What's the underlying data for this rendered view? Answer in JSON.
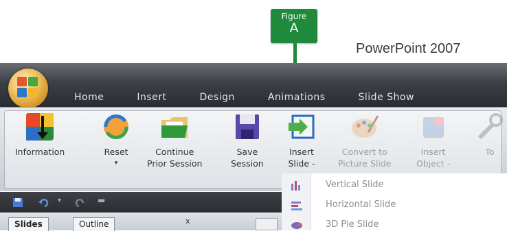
{
  "callout": {
    "line1": "Figure",
    "line2": "A"
  },
  "product_title": "PowerPoint 2007",
  "tabs": [
    "Home",
    "Insert",
    "Design",
    "Animations",
    "Slide Show"
  ],
  "ribbon": {
    "information": "Information",
    "reset": "Reset",
    "continue_l1": "Continue",
    "continue_l2": "Prior Session",
    "save_l1": "Save",
    "save_l2": "Session",
    "insert_l1": "Insert",
    "insert_l2": "Slide -",
    "convert_l1": "Convert to",
    "convert_l2": "Picture Slide",
    "insobj_l1": "Insert",
    "insobj_l2": "Object -",
    "cut_l1": "To"
  },
  "panes": {
    "slides": "Slides",
    "outline": "Outline",
    "close": "x"
  },
  "menu": [
    "Vertical Slide",
    "Horizontal Slide",
    "3D Pie Slide"
  ],
  "colors": {
    "callout_green": "#1f8a3c",
    "highlight": "#ffd57a"
  }
}
